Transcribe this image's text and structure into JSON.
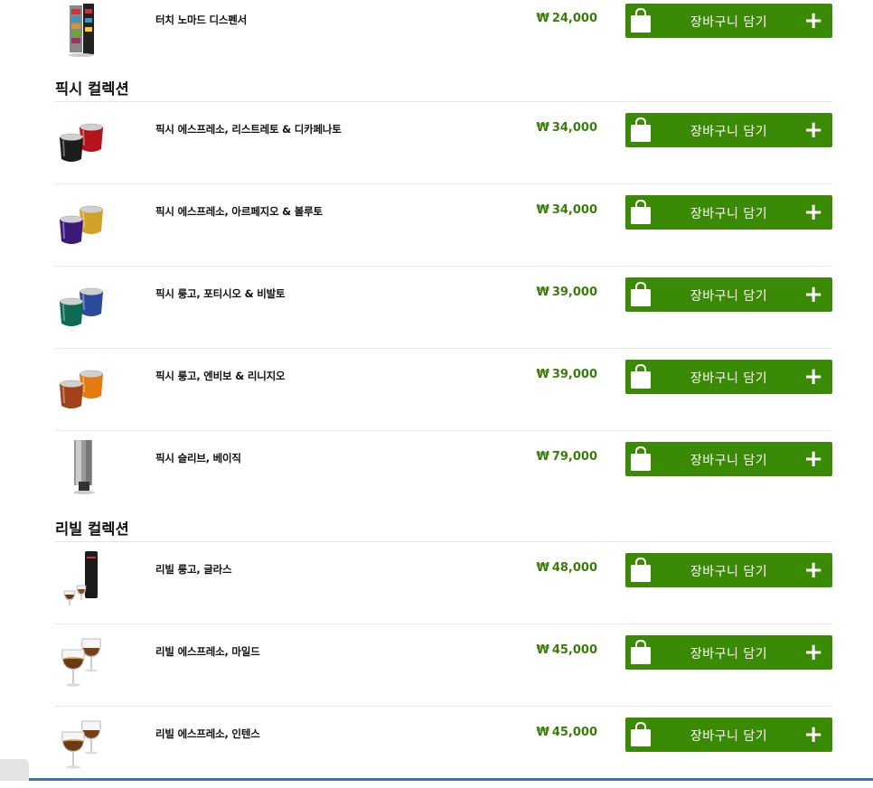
{
  "cart_button_label": "장바구니 담기",
  "currency_symbol": "₩",
  "sections": [
    {
      "title": "",
      "products": [
        {
          "name": "터치 노마드 디스펜서",
          "price": "24,000",
          "image": "dispenser-tower"
        }
      ]
    },
    {
      "title": "픽시 컬렉션",
      "products": [
        {
          "name": "픽시 에스프레소, 리스트레토 & 디카페나토",
          "price": "34,000",
          "image": "cups-black-red"
        },
        {
          "name": "픽시 에스프레소, 아르페지오 & 볼루토",
          "price": "34,000",
          "image": "cups-purple-gold"
        },
        {
          "name": "픽시 룽고, 포티시오 & 비발토",
          "price": "39,000",
          "image": "cups-green-blue"
        },
        {
          "name": "픽시 룽고, 엔비보 & 리니지오",
          "price": "39,000",
          "image": "cups-copper-orange"
        },
        {
          "name": "픽시 슬리브, 베이직",
          "price": "79,000",
          "image": "sleeve-tower"
        }
      ]
    },
    {
      "title": "리빌 컬렉션",
      "products": [
        {
          "name": "리빌 룽고, 글라스",
          "price": "48,000",
          "image": "reveal-lungo-glass"
        },
        {
          "name": "리빌 에스프레소, 마일드",
          "price": "45,000",
          "image": "reveal-glasses"
        },
        {
          "name": "리빌 에스프레소, 인텐스",
          "price": "45,000",
          "image": "reveal-glasses"
        }
      ]
    }
  ],
  "colors": {
    "button": "#3b8a05",
    "price": "#3a7d0a"
  }
}
